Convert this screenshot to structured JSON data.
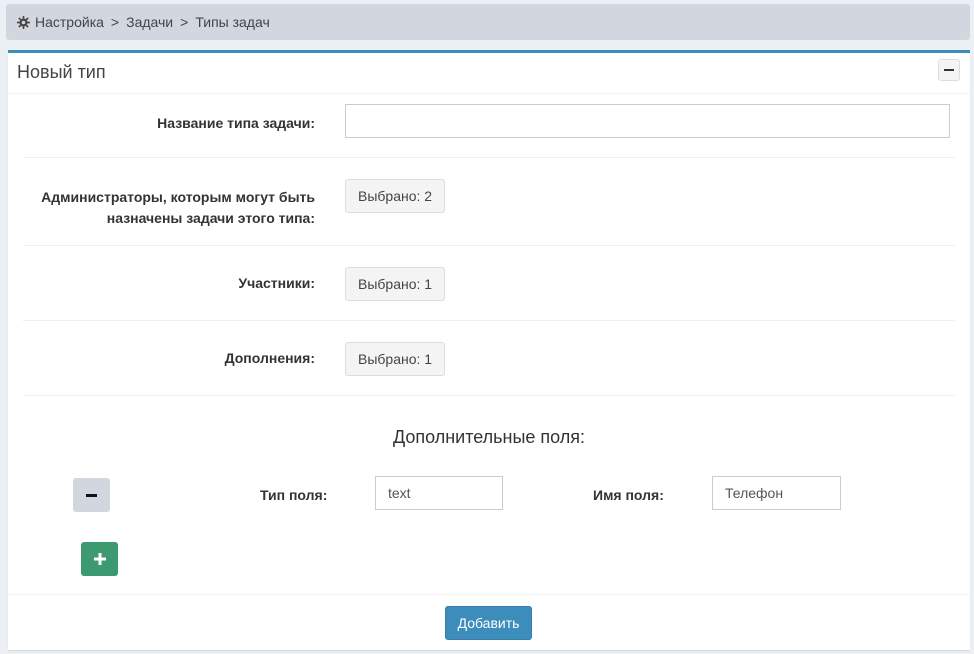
{
  "breadcrumb": {
    "icon": "gear-icon",
    "items": [
      "Настройка",
      "Задачи",
      "Типы задач"
    ],
    "separator": ">"
  },
  "box": {
    "title": "Новый тип",
    "collapse_icon": "minus-icon",
    "accent_color": "#3c8dbc"
  },
  "form": {
    "name": {
      "label": "Название типа задачи:",
      "value": "",
      "placeholder": ""
    },
    "admins": {
      "label_line1": "Администраторы, которым могут быть",
      "label_line2": "назначены задачи этого типа:",
      "button": "Выбрано: 2"
    },
    "participants": {
      "label": "Участники:",
      "button": "Выбрано: 1"
    },
    "addons": {
      "label": "Дополнения:",
      "button": "Выбрано: 1"
    }
  },
  "extra_fields": {
    "title": "Дополнительные поля:",
    "rows": [
      {
        "type_label": "Тип поля:",
        "type_value": "text",
        "name_label": "Имя поля:",
        "name_value": "Телефон",
        "remove_icon": "minus-icon"
      }
    ],
    "add_icon": "plus-icon",
    "add_color": "#3d9970"
  },
  "footer": {
    "submit_label": "Добавить",
    "submit_color": "#3c8dbc"
  }
}
